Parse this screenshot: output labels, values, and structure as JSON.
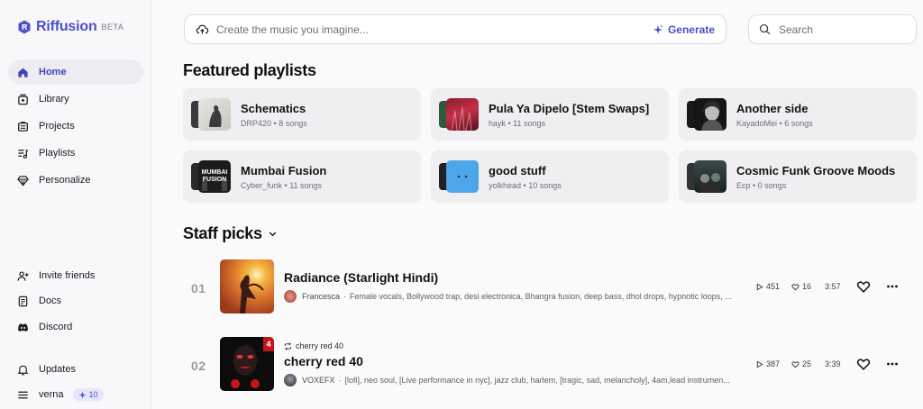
{
  "brand": {
    "name": "Riffusion",
    "badge": "BETA",
    "accent": "#4b4fc8"
  },
  "sidebar": {
    "primary": [
      {
        "label": "Home",
        "icon": "home-icon",
        "active": true
      },
      {
        "label": "Library",
        "icon": "library-icon"
      },
      {
        "label": "Projects",
        "icon": "projects-icon"
      },
      {
        "label": "Playlists",
        "icon": "playlists-icon"
      },
      {
        "label": "Personalize",
        "icon": "diamond-icon"
      }
    ],
    "secondary": [
      {
        "label": "Invite friends",
        "icon": "user-plus-icon"
      },
      {
        "label": "Docs",
        "icon": "docs-icon"
      },
      {
        "label": "Discord",
        "icon": "discord-icon"
      }
    ],
    "updates_label": "Updates",
    "user": {
      "name": "verna",
      "credits": "10"
    }
  },
  "prompt": {
    "placeholder": "Create the music you imagine...",
    "generate_label": "Generate"
  },
  "search": {
    "placeholder": "Search"
  },
  "featured": {
    "title": "Featured playlists",
    "playlists": [
      {
        "title": "Schematics",
        "author": "DRP420",
        "count": "8 songs"
      },
      {
        "title": "Pula Ya Dipelo [Stem Swaps]",
        "author": "hayk",
        "count": "11 songs"
      },
      {
        "title": "Another side",
        "author": "KayadoMei",
        "count": "6 songs"
      },
      {
        "title": "Mumbai Fusion",
        "author": "Cyber_funk",
        "count": "11 songs"
      },
      {
        "title": "good stuff",
        "author": "yolkhead",
        "count": "10 songs"
      },
      {
        "title": "Cosmic Funk Groove Moods",
        "author": "Ecp",
        "count": "0 songs"
      }
    ]
  },
  "staff": {
    "title": "Staff picks",
    "tracks": [
      {
        "num": "01",
        "title": "Radiance (Starlight Hindi)",
        "author": "Francesca",
        "tags": "Female vocals, Bollywood trap, desi electronica, Bhangra fusion, deep bass, dhol drops, hypnotic loops, ...",
        "plays": "451",
        "likes": "16",
        "duration": "3:57"
      },
      {
        "num": "02",
        "remix_of": "cherry red 40",
        "title": "cherry red 40",
        "author": "VOXEFX",
        "tags": "[lofi], neo soul, [Live performance in nyc], jazz club, harlem, [tragic, sad, melancholy], 4am,lead instrumen...",
        "plays": "387",
        "likes": "25",
        "duration": "3:39"
      }
    ]
  }
}
